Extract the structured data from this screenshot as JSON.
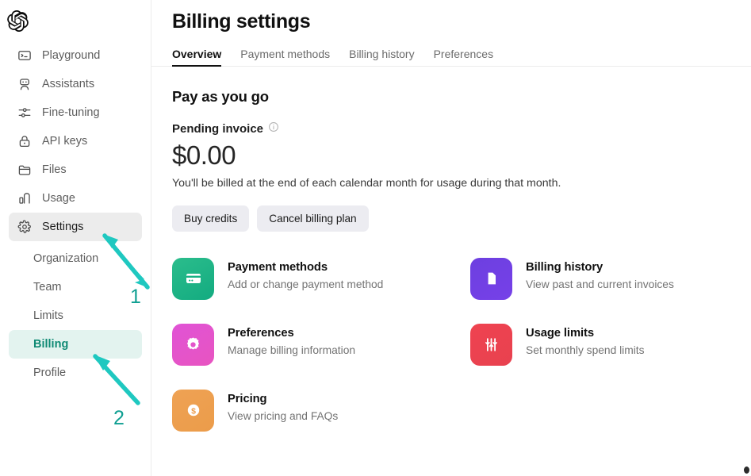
{
  "brand": {
    "logo_icon": "openai-logo-icon"
  },
  "sidebar": {
    "items": [
      {
        "label": "Playground",
        "icon": "playground-terminal-icon"
      },
      {
        "label": "Assistants",
        "icon": "robot-icon"
      },
      {
        "label": "Fine-tuning",
        "icon": "sliders-icon"
      },
      {
        "label": "API keys",
        "icon": "lock-icon"
      },
      {
        "label": "Files",
        "icon": "folder-icon"
      },
      {
        "label": "Usage",
        "icon": "bar-chart-icon"
      },
      {
        "label": "Settings",
        "icon": "gear-icon",
        "active": true
      }
    ],
    "sub_items": [
      {
        "label": "Organization"
      },
      {
        "label": "Team"
      },
      {
        "label": "Limits"
      },
      {
        "label": "Billing",
        "selected": true
      },
      {
        "label": "Profile"
      }
    ],
    "selected_color": "#0f8a74",
    "selected_bg": "#e3f3ef"
  },
  "header": {
    "title": "Billing settings",
    "tabs": [
      {
        "label": "Overview",
        "active": true
      },
      {
        "label": "Payment methods",
        "active": false
      },
      {
        "label": "Billing history",
        "active": false
      },
      {
        "label": "Preferences",
        "active": false
      }
    ]
  },
  "overview": {
    "section_heading": "Pay as you go",
    "pending_invoice_label": "Pending invoice",
    "pending_invoice_info_icon": "info-circle-icon",
    "amount": "$0.00",
    "billed_note": "You'll be billed at the end of each calendar month for usage during that month.",
    "buttons": [
      {
        "label": "Buy credits"
      },
      {
        "label": "Cancel billing plan"
      }
    ]
  },
  "cards": [
    {
      "title": "Payment methods",
      "subtitle": "Add or change payment method",
      "icon": "credit-card-icon",
      "tile_class": "t-green",
      "color": "#17b183"
    },
    {
      "title": "Billing history",
      "subtitle": "View past and current invoices",
      "icon": "document-icon",
      "tile_class": "t-purple",
      "color": "#7240e4"
    },
    {
      "title": "Preferences",
      "subtitle": "Manage billing information",
      "icon": "gear-icon",
      "tile_class": "t-pink",
      "color": "#e354cb"
    },
    {
      "title": "Usage limits",
      "subtitle": "Set monthly spend limits",
      "icon": "vertical-sliders-icon",
      "tile_class": "t-red",
      "color": "#ec4250"
    },
    {
      "title": "Pricing",
      "subtitle": "View pricing and FAQs",
      "icon": "dollar-circle-icon",
      "tile_class": "t-orange",
      "color": "#ed9e4e"
    }
  ],
  "annotations": {
    "arrow_color": "#1fc8c0",
    "number_color": "#0f9f92",
    "markers": [
      {
        "number": "1",
        "points_to": "sidebar-item-settings"
      },
      {
        "number": "2",
        "points_to": "sidebar-subitem-billing"
      }
    ]
  }
}
